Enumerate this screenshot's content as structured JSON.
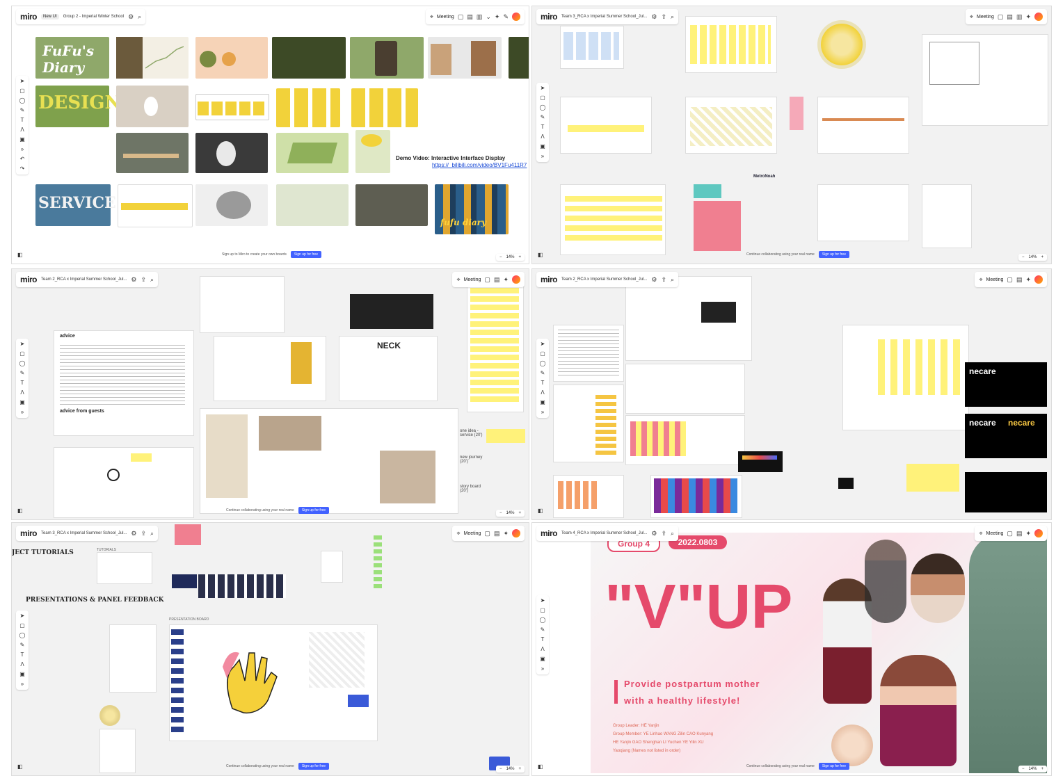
{
  "app": {
    "logo": "miro"
  },
  "panes": [
    {
      "board_name": "Group 2 - Imperial Winter School",
      "tag": "New UI"
    },
    {
      "board_name": "Team 3_RCA x Imperial Summer School_Jul..."
    },
    {
      "board_name": "Team 2_RCA x Imperial Summer School_Jul..."
    },
    {
      "board_name": "Team 2_RCA x Imperial Summer School_Jul..."
    },
    {
      "board_name": "Team 3_RCA x Imperial Summer School_Jul..."
    },
    {
      "board_name": "Team 4_RCA x Imperial Summer School_Jul..."
    }
  ],
  "common": {
    "meeting_label": "Meeting",
    "signup_text": "Sign up to Miro to create your own boards",
    "signup_button": "Sign up for free",
    "continue_text": "Continue collaborating using your real name",
    "zoom": "14%",
    "zoom_minus": "−",
    "zoom_plus": "+"
  },
  "pane1": {
    "fufu_title": "FuFu's Diary",
    "design_word": "DESIGN",
    "service_word": "SERVICE",
    "fufu_small": "fufu diary",
    "demo_label": "Demo Video:  Interactive Interface Display",
    "demo_link": "https://_bilibili.com/video/BV1Fu411R7"
  },
  "pane2": {
    "brand": "MetroNoah"
  },
  "pane3": {
    "advice_title": "advice",
    "advice_guests": "advice from guests",
    "neck_title": "NECK",
    "labels": [
      "one idea -service (20')",
      "new journey (20')",
      "story board (20')"
    ]
  },
  "pane4": {
    "necare": [
      "necare",
      "necare",
      "necare"
    ]
  },
  "pane5": {
    "heading1": "JECT TUTORIALS",
    "heading2": "PRESENTATIONS & PANEL FEEDBACK",
    "sub1": "TUTORIALS",
    "sub2": "PRESENTATION BOARD"
  },
  "pane6": {
    "group": "Group 4",
    "date": "2022.0803",
    "title": "\"V\"UP",
    "slogan_1": "Provide postpartum mother",
    "slogan_2": "with a healthy lifestyle!",
    "credits": [
      "Group Leader: HE Yanjin",
      "Group Member: YE Linhao  WANG Zilin  CAO Kunyang",
      "HE Yanjin  GAO Shenghan  LI Yuchen  YE Yilin  XU",
      "Yaoqiang  (Names not listed in order)"
    ]
  },
  "colors": {
    "miro_blue": "#4262ff",
    "fufu_green": "#8fa86a",
    "dark_green": "#3d4a26",
    "vup_pink": "#e54a6b",
    "sticky_yellow": "#fff27a"
  }
}
